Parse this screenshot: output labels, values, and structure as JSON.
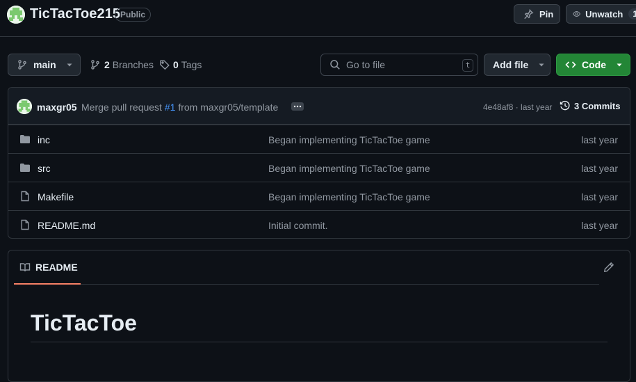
{
  "repo": {
    "name": "TicTacToe215",
    "visibility": "Public",
    "pin_label": "Pin",
    "unwatch_label": "Unwatch",
    "watch_count": "1"
  },
  "toolbar": {
    "branch": "main",
    "branches_count": "2",
    "branches_label": "Branches",
    "tags_count": "0",
    "tags_label": "Tags",
    "search_placeholder": "Go to file",
    "search_shortcut": "t",
    "add_file_label": "Add file",
    "code_label": "Code"
  },
  "latest_commit": {
    "author": "maxgr05",
    "message_prefix": "Merge pull request",
    "pr_link": "#1",
    "message_suffix": "from maxgr05/template",
    "hash": "4e48af8 · last year",
    "commits_label": "3 Commits"
  },
  "files": [
    {
      "name": "inc",
      "type": "folder",
      "message": "Began implementing TicTacToe game",
      "date": "last year"
    },
    {
      "name": "src",
      "type": "folder",
      "message": "Began implementing TicTacToe game",
      "date": "last year"
    },
    {
      "name": "Makefile",
      "type": "file",
      "message": "Began implementing TicTacToe game",
      "date": "last year"
    },
    {
      "name": "README.md",
      "type": "file",
      "message": "Initial commit.",
      "date": "last year"
    }
  ],
  "readme": {
    "tab_label": "README",
    "title": "TicTacToe"
  },
  "colors": {
    "background": "#0d1117",
    "border": "#30363d",
    "muted_text": "#9198a1",
    "link": "#4493f8",
    "code_button": "#238636",
    "tab_underline": "#f78166"
  },
  "icons": {
    "folder": "folder-icon",
    "file": "file-icon"
  }
}
